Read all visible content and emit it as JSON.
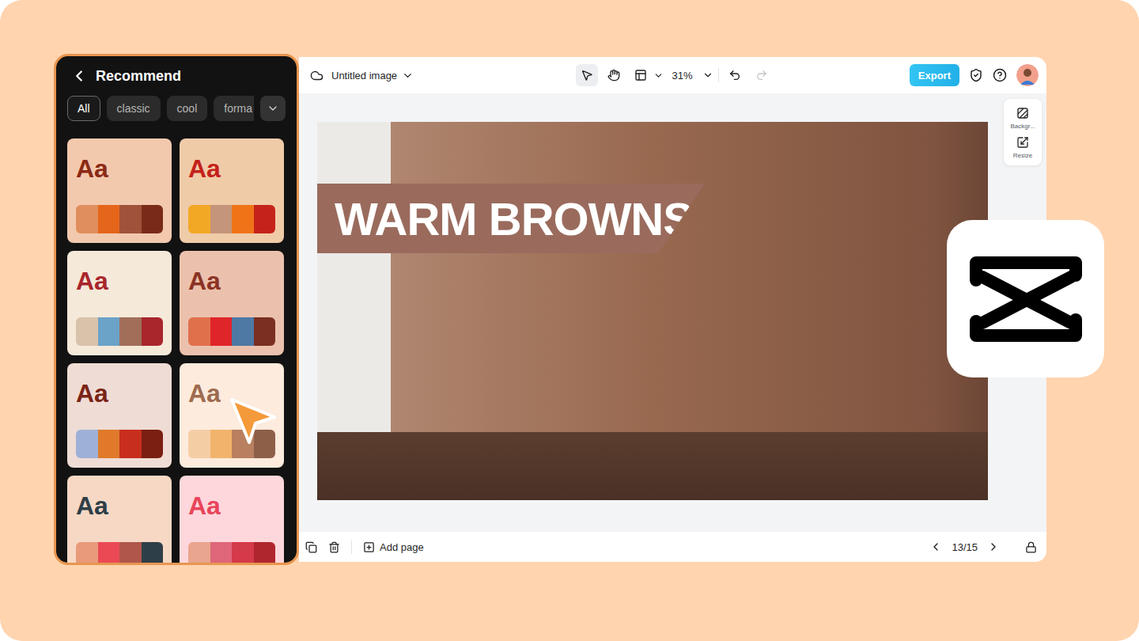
{
  "panel": {
    "title": "Recommend",
    "filters": [
      {
        "label": "All",
        "selected": true
      },
      {
        "label": "classic",
        "selected": false
      },
      {
        "label": "cool",
        "selected": false
      },
      {
        "label": "forma",
        "selected": false
      }
    ],
    "palettes": [
      {
        "sample": "Aa",
        "color": "#8B2A14",
        "background": "#F3C9AE",
        "swatches": [
          "#E08E5E",
          "#E5651B",
          "#A0533A",
          "#7A2B18"
        ],
        "selected": false
      },
      {
        "sample": "Aa",
        "color": "#C4221A",
        "background": "#F0CBA8",
        "swatches": [
          "#F2A825",
          "#C4957A",
          "#F07417",
          "#C5231A"
        ],
        "selected": false
      },
      {
        "sample": "Aa",
        "color": "#A8262C",
        "background": "#F5E9DA",
        "swatches": [
          "#D9C2AA",
          "#6BA2C8",
          "#A26E59",
          "#A8262C"
        ],
        "selected": false
      },
      {
        "sample": "Aa",
        "color": "#8B3324",
        "background": "#EBC1AD",
        "swatches": [
          "#E0704C",
          "#E0252A",
          "#4E79A5",
          "#7A2F22"
        ],
        "selected": false
      },
      {
        "sample": "Aa",
        "color": "#7A2416",
        "background": "#EFDCD5",
        "swatches": [
          "#9FB0D8",
          "#E07A2A",
          "#C82E1D",
          "#7A1F12"
        ],
        "selected": false
      },
      {
        "sample": "Aa",
        "color": "#9E6B4F",
        "background": "#FDEBDD",
        "swatches": [
          "#F5CDA5",
          "#F2B46C",
          "#B98060",
          "#8E5F48"
        ],
        "selected": true
      },
      {
        "sample": "Aa",
        "color": "#2E3E48",
        "background": "#F6D8C5",
        "swatches": [
          "#E99A7B",
          "#EB4A55",
          "#B0564B",
          "#2E3E48"
        ],
        "selected": false
      },
      {
        "sample": "Aa",
        "color": "#E8455A",
        "background": "#FDD7DC",
        "swatches": [
          "#E9A58E",
          "#E0667A",
          "#D43A4A",
          "#B0262E"
        ],
        "selected": false
      }
    ]
  },
  "editor": {
    "title": "Untitled image",
    "tools": [
      {
        "kind": "select",
        "selected": true
      },
      {
        "kind": "hand",
        "selected": false
      }
    ],
    "zoom": "31%",
    "undo_enabled": true,
    "redo_enabled": false,
    "export": "Export",
    "side_tools": [
      {
        "kind": "background",
        "label": "Backgr..."
      },
      {
        "kind": "resize",
        "label": "Resize"
      }
    ],
    "canvas": {
      "headline": "WARM BROWNS"
    },
    "add_page": "Add page",
    "page": "13/15"
  }
}
